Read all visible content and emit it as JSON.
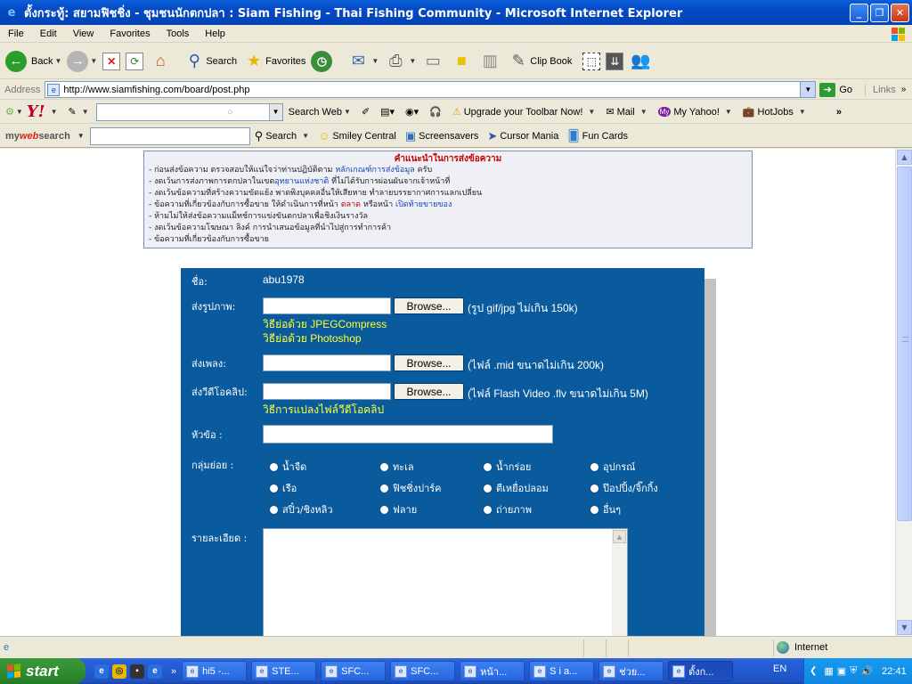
{
  "window": {
    "title": "ตั้งกระทู้: สยามฟิชชิ่ง - ชุมชนนักตกปลา : Siam Fishing - Thai Fishing Community - Microsoft Internet Explorer"
  },
  "menu": [
    "File",
    "Edit",
    "View",
    "Favorites",
    "Tools",
    "Help"
  ],
  "toolbar": {
    "back": "Back",
    "search": "Search",
    "favorites": "Favorites",
    "clipbook": "Clip Book"
  },
  "address": {
    "label": "Address",
    "url": "http://www.siamfishing.com/board/post.php",
    "go": "Go",
    "links": "Links"
  },
  "yahoo": {
    "search_web": "Search Web",
    "upgrade": "Upgrade your Toolbar Now!",
    "mail": "Mail",
    "my_yahoo": "My Yahoo!",
    "hotjobs": "HotJobs"
  },
  "mws": {
    "logo_a": "my",
    "logo_b": "web",
    "logo_c": "search",
    "search": "Search",
    "smiley": "Smiley Central",
    "screensavers": "Screensavers",
    "cursor": "Cursor Mania",
    "funcards": "Fun Cards"
  },
  "rules": {
    "title": "คำแนะนำในการส่งข้อความ",
    "l1a": "- ก่อนส่งข้อความ ตรวจสอบให้แน่ใจว่าท่านปฏิบัติตาม ",
    "l1b": "หลักเกณฑ์การส่งข้อมูล",
    "l1c": " ครับ",
    "l2a": "- งดเว้นการส่งภาพการตกปลาในเขต",
    "l2b": "อุทยานแห่งชาติ",
    "l2c": " ที่ไม่ได้รับการผ่อนผันจากเจ้าหน้าที่",
    "l3": "- งดเว้นข้อความที่สร้างความขัดแย้ง พาดพิงบุคคลอื่นให้เสียหาย ทำลายบรรยากาศการแลกเปลี่ยน",
    "l4a": "- ข้อความที่เกี่ยวข้องกับการซื้อขาย ให้ดำเนินการที่หน้า ",
    "l4b": "ตลาด",
    "l4c": " หรือหน้า ",
    "l4d": "เปิดท้ายขายของ",
    "l5": "- ห้ามไม่ให้ส่งข้อความแม็ทช์การแข่งขันตกปลาเพื่อชิงเงินรางวัล",
    "l6": "- งดเว้นข้อความโฆษณา ลิงค์ การนำเสนอข้อมูลที่นำไปสู่การทำการค้า",
    "l7": "- ข้อความที่เกี่ยวข้องกับการซื้อขาย"
  },
  "form": {
    "name_label": "ชื่อ:",
    "name_value": "abu1978",
    "image_label": "ส่งรูปภาพ:",
    "image_hint": "(รูป gif/jpg ไม่เกิน 150k)",
    "image_link1": "วิธีย่อด้วย JPEGCompress",
    "image_link2": "วิธีย่อด้วย Photoshop",
    "music_label": "ส่งเพลง:",
    "music_hint": "(ไฟล์ .mid ขนาดไม่เกิน 200k)",
    "video_label": "ส่งวีดีโอคลิป:",
    "video_hint": "(ไฟล์ Flash Video .flv ขนาดไม่เกิน 5M)",
    "video_link": "วิธีการแปลงไฟล์วีดีโอคลิป",
    "browse": "Browse...",
    "subject_label": "หัวข้อ :",
    "group_label": "กลุ่มย่อย :",
    "groups": [
      "น้ำจืด",
      "ทะเล",
      "น้ำกร่อย",
      "อุปกรณ์",
      "เรือ",
      "ฟิชชิ่งปาร์ค",
      "ตีเหยื่อปลอม",
      "ป๊อปปิ้ง/จิ๊กกิ้ง",
      "สปิ๋ว/ชิงหลิว",
      "ฟลาย",
      "ถ่ายภาพ",
      "อื่นๆ"
    ],
    "detail_label": "รายละเอียด :"
  },
  "status": {
    "zone": "Internet"
  },
  "taskbar": {
    "start": "start",
    "tasks": [
      "hi5 -...",
      "STE...",
      "SFC...",
      "SFC...",
      "หน้า...",
      "S i a...",
      "ช่วย...",
      "ตั้งก..."
    ],
    "lang": "EN",
    "clock": "22:41"
  }
}
